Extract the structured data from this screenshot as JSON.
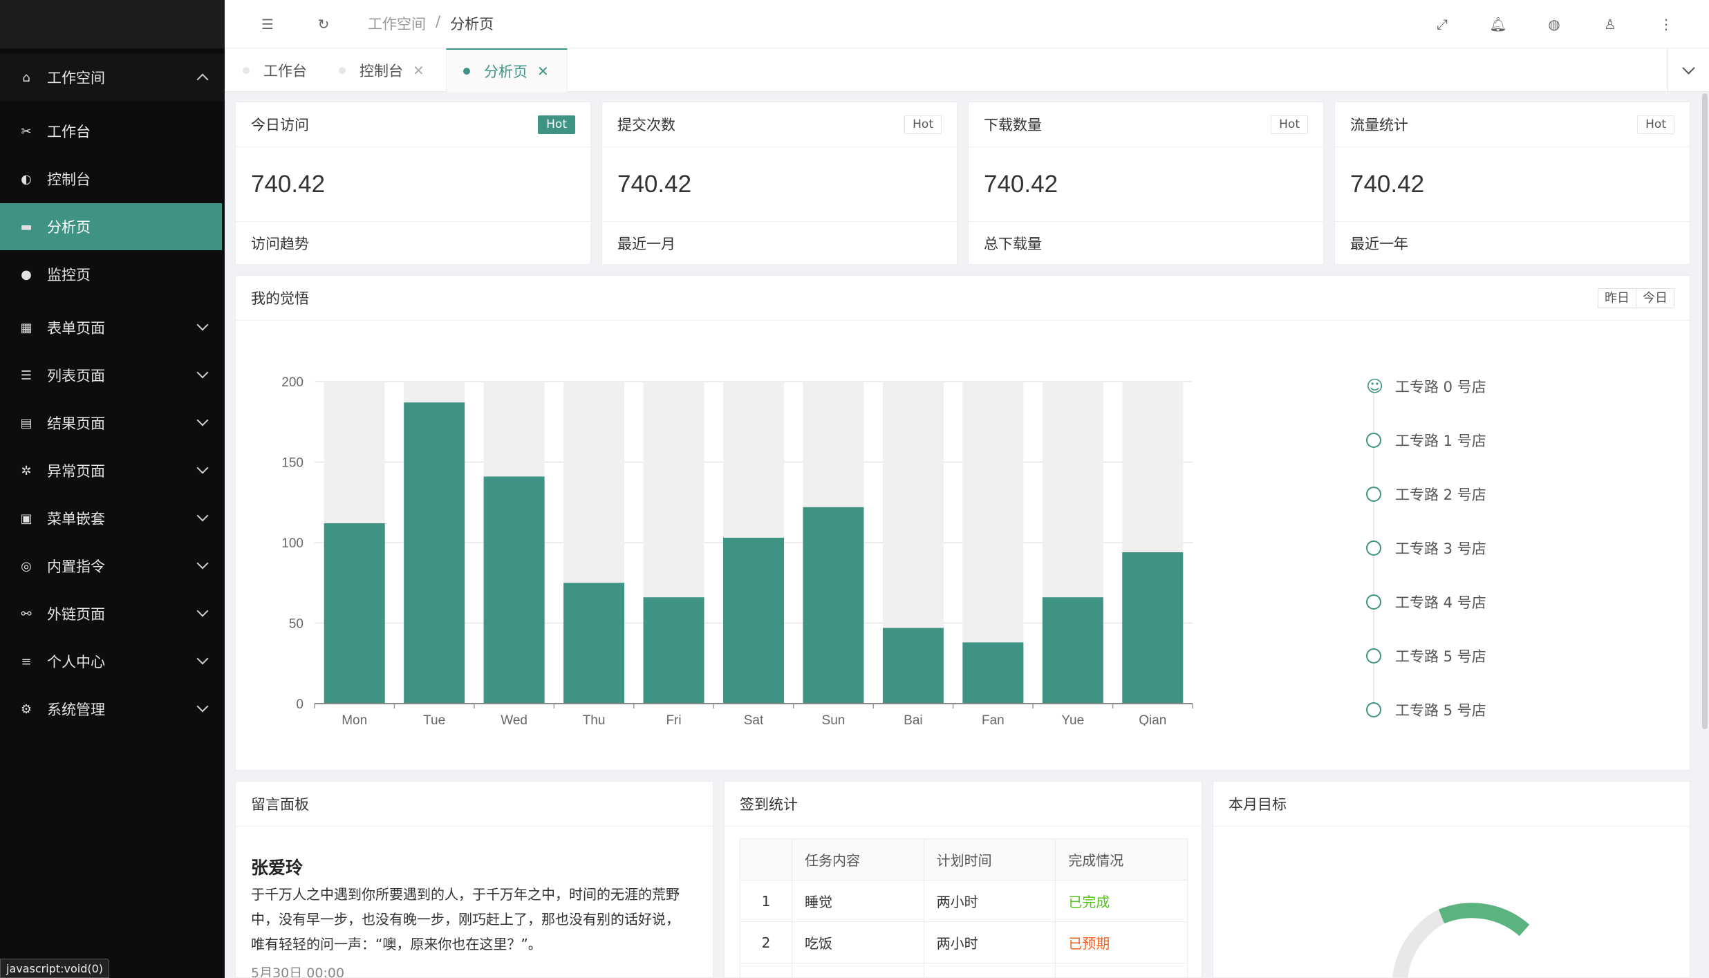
{
  "sidebar": {
    "workspace": {
      "label": "工作空间",
      "icon": "home-icon"
    },
    "sub_items": [
      {
        "label": "工作台",
        "icon": "tools-icon"
      },
      {
        "label": "控制台",
        "icon": "console-icon"
      },
      {
        "label": "分析页",
        "icon": "chart-icon"
      },
      {
        "label": "监控页",
        "icon": "monitor-icon"
      }
    ],
    "groups": [
      {
        "label": "表单页面",
        "icon": "form-icon"
      },
      {
        "label": "列表页面",
        "icon": "list-icon"
      },
      {
        "label": "结果页面",
        "icon": "result-icon"
      },
      {
        "label": "异常页面",
        "icon": "error-icon"
      },
      {
        "label": "菜单嵌套",
        "icon": "menu-icon"
      },
      {
        "label": "内置指令",
        "icon": "directive-icon"
      },
      {
        "label": "外链页面",
        "icon": "link-icon"
      },
      {
        "label": "个人中心",
        "icon": "settings-sliders-icon"
      },
      {
        "label": "系统管理",
        "icon": "gear-icon"
      }
    ]
  },
  "header": {
    "breadcrumb": [
      "工作空间",
      "/",
      "分析页"
    ]
  },
  "tabs": [
    {
      "label": "工作台"
    },
    {
      "label": "控制台",
      "close": "✕"
    },
    {
      "label": "分析页",
      "close": "✕"
    }
  ],
  "stats": [
    {
      "title": "今日访问",
      "badge": "Hot",
      "value": "740.42",
      "footer": "访问趋势"
    },
    {
      "title": "提交次数",
      "badge": "Hot",
      "value": "740.42",
      "footer": "最近一月"
    },
    {
      "title": "下载数量",
      "badge": "Hot",
      "value": "740.42",
      "footer": "总下载量"
    },
    {
      "title": "流量统计",
      "badge": "Hot",
      "value": "740.42",
      "footer": "最近一年"
    }
  ],
  "chart_panel": {
    "title": "我的觉悟",
    "buttons": [
      "昨日",
      "今日"
    ]
  },
  "chart_data": {
    "type": "bar",
    "categories": [
      "Mon",
      "Tue",
      "Wed",
      "Thu",
      "Fri",
      "Sat",
      "Sun",
      "Bai",
      "Fan",
      "Yue",
      "Qian"
    ],
    "values": [
      112,
      187,
      141,
      75,
      66,
      103,
      122,
      47,
      38,
      66,
      94
    ],
    "background_max": 200,
    "yticks": [
      0,
      50,
      100,
      150,
      200
    ],
    "ylim": [
      0,
      200
    ],
    "grid": true,
    "colors": {
      "bar": "#3f9384",
      "background": "#f0f0f0"
    }
  },
  "timeline": [
    "工专路 0 号店",
    "工专路 1 号店",
    "工专路 2 号店",
    "工专路 3 号店",
    "工专路 4 号店",
    "工专路 5 号店",
    "工专路 5 号店"
  ],
  "message_board": {
    "title": "留言面板",
    "name": "张爱玲",
    "text": "于千万人之中遇到你所要遇到的人，于千万年之中，时间的无涯的荒野中，没有早一步，也没有晚一步，刚巧赶上了，那也没有别的话好说，唯有轻轻的问一声：“噢，原来你也在这里？”。",
    "date": "5月30日 00:00"
  },
  "sign_stats": {
    "title": "签到统计",
    "headers": [
      "",
      "任务内容",
      "计划时间",
      "完成情况"
    ],
    "rows": [
      {
        "no": "1",
        "task": "睡觉",
        "time": "两小时",
        "status": "已完成"
      },
      {
        "no": "2",
        "task": "吃饭",
        "time": "两小时",
        "status": "已预期"
      }
    ]
  },
  "goal": {
    "title": "本月目标"
  },
  "status_bar": "javascript:void(0)",
  "colors": {
    "accent": "#3f9384",
    "success": "#52c41a",
    "overdue": "#f5601e",
    "sidebar_bg": "#0d0d0d"
  }
}
